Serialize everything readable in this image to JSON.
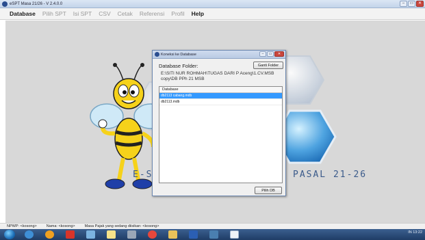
{
  "window": {
    "title": "eSPT Masa 21/26 - V 2.4.0.0",
    "buttons": {
      "minimize": "–",
      "maximize": "▭",
      "close": "✕"
    }
  },
  "menu": {
    "items": [
      {
        "label": "Database",
        "active": true
      },
      {
        "label": "Pilih SPT",
        "active": false
      },
      {
        "label": "Isi SPT",
        "active": false
      },
      {
        "label": "CSV",
        "active": false
      },
      {
        "label": "Cetak",
        "active": false
      },
      {
        "label": "Referensi",
        "active": false
      },
      {
        "label": "Profil",
        "active": false
      },
      {
        "label": "Help",
        "active": true
      }
    ]
  },
  "background": {
    "brand_left": "E-SP",
    "brand_right": "PASAL 21-26"
  },
  "dialog": {
    "title": "Koneksi ke Database",
    "folder_label": "Database Folder:",
    "change_folder_button": "Ganti Folder",
    "folder_path": "E:\\SITI NUR ROHMAH\\TUGAS DARI P Aceng\\1.CV.MSB copy\\DB PPh 21 MSB",
    "list_header": "Database",
    "rows": [
      {
        "name": "db2113 cabang.mdb",
        "selected": true
      },
      {
        "name": "db2113.mdb",
        "selected": false
      }
    ],
    "select_button": "Pilih DB"
  },
  "status": {
    "npwp": "NPWP: <kosong>",
    "nama": "Nama: <kosong>",
    "masa": "Masa Pajak yang sedang diisikan: <kosong>"
  },
  "taskbar": {
    "clock": "13:22",
    "tray": "IN"
  },
  "colors": {
    "selection": "#3399ff",
    "accent_blue": "#2a4d8f",
    "close_red": "#c9463d"
  }
}
